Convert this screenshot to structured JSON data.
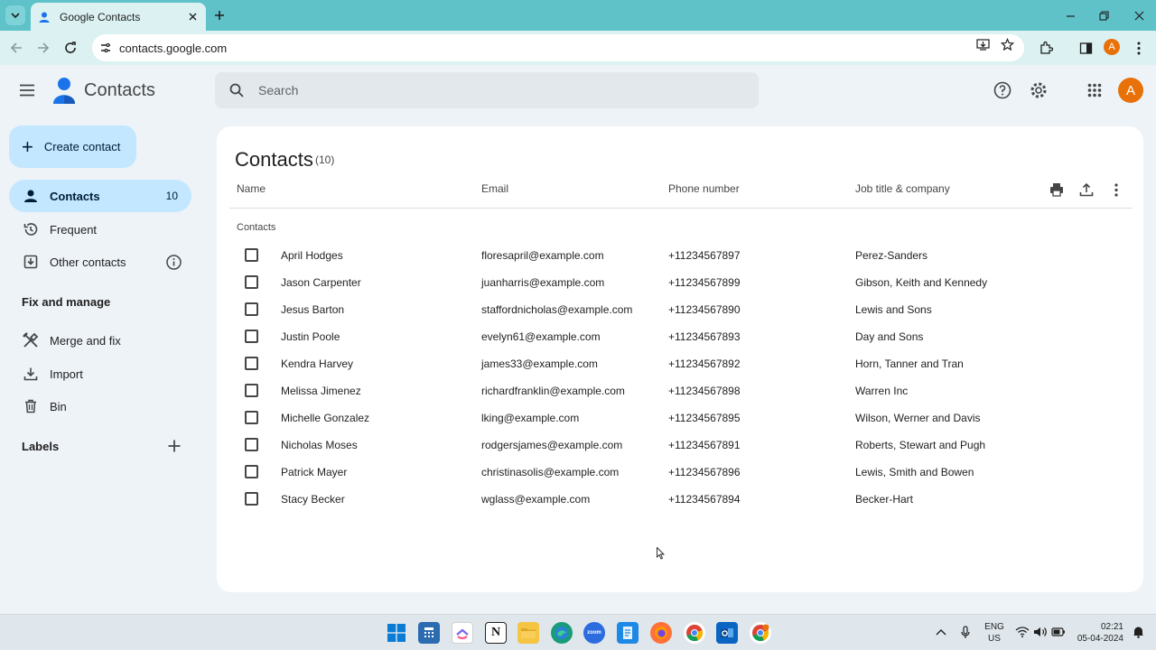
{
  "browser": {
    "tab_title": "Google Contacts",
    "url": "contacts.google.com",
    "profile_initial": "A"
  },
  "app": {
    "name": "Contacts",
    "search_placeholder": "Search",
    "avatar_initial": "A"
  },
  "sidebar": {
    "create_label": "Create contact",
    "items": [
      {
        "label": "Contacts",
        "count": "10",
        "icon": "person-icon"
      },
      {
        "label": "Frequent",
        "icon": "history-icon"
      },
      {
        "label": "Other contacts",
        "icon": "download-box-icon"
      }
    ],
    "fix_title": "Fix and manage",
    "fix_items": [
      {
        "label": "Merge and fix",
        "icon": "tools-icon"
      },
      {
        "label": "Import",
        "icon": "import-icon"
      },
      {
        "label": "Bin",
        "icon": "trash-icon"
      }
    ],
    "labels_title": "Labels"
  },
  "main": {
    "title": "Contacts",
    "count": "(10)",
    "columns": [
      "Name",
      "Email",
      "Phone number",
      "Job title & company"
    ],
    "group_label": "Contacts",
    "rows": [
      {
        "name": "April Hodges",
        "email": "floresapril@example.com",
        "phone": "+11234567897",
        "company": "Perez-Sanders"
      },
      {
        "name": "Jason Carpenter",
        "email": "juanharris@example.com",
        "phone": "+11234567899",
        "company": "Gibson, Keith and Kennedy"
      },
      {
        "name": "Jesus Barton",
        "email": "staffordnicholas@example.com",
        "phone": "+11234567890",
        "company": "Lewis and Sons"
      },
      {
        "name": "Justin Poole",
        "email": "evelyn61@example.com",
        "phone": "+11234567893",
        "company": "Day and Sons"
      },
      {
        "name": "Kendra Harvey",
        "email": "james33@example.com",
        "phone": "+11234567892",
        "company": "Horn, Tanner and Tran"
      },
      {
        "name": "Melissa Jimenez",
        "email": "richardfranklin@example.com",
        "phone": "+11234567898",
        "company": "Warren Inc"
      },
      {
        "name": "Michelle Gonzalez",
        "email": "lking@example.com",
        "phone": "+11234567895",
        "company": "Wilson, Werner and Davis"
      },
      {
        "name": "Nicholas Moses",
        "email": "rodgersjames@example.com",
        "phone": "+11234567891",
        "company": "Roberts, Stewart and Pugh"
      },
      {
        "name": "Patrick Mayer",
        "email": "christinasolis@example.com",
        "phone": "+11234567896",
        "company": "Lewis, Smith and Bowen"
      },
      {
        "name": "Stacy Becker",
        "email": "wglass@example.com",
        "phone": "+11234567894",
        "company": "Becker-Hart"
      }
    ]
  },
  "taskbar": {
    "lang_line1": "ENG",
    "lang_line2": "US",
    "time": "02:21",
    "date": "05-04-2024"
  },
  "colors": {
    "accent": "#c2e7ff",
    "tabstrip": "#5fc2c9",
    "avatar": "#e8710a"
  }
}
